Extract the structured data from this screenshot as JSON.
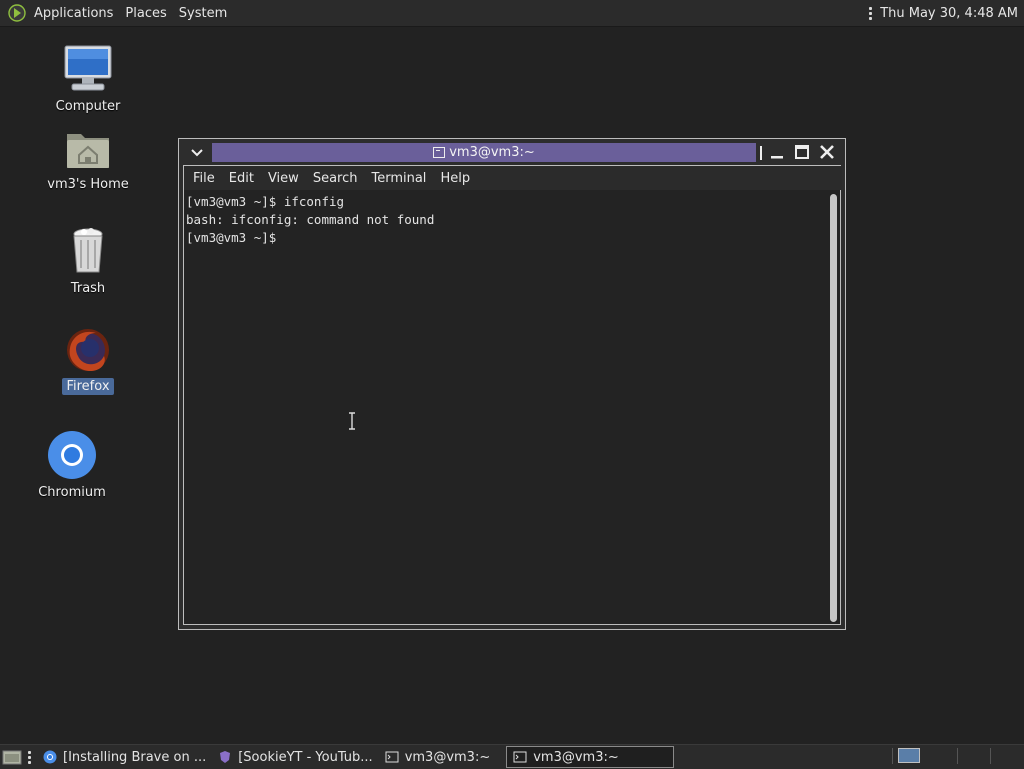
{
  "top_panel": {
    "menus": [
      "Applications",
      "Places",
      "System"
    ],
    "clock": "Thu May 30,  4:48 AM"
  },
  "desktop": {
    "icons": [
      {
        "label": "Computer",
        "icon": "computer-icon"
      },
      {
        "label": "vm3's Home",
        "icon": "home-folder-icon"
      },
      {
        "label": "Trash",
        "icon": "trash-icon"
      },
      {
        "label": "Firefox",
        "icon": "firefox-icon",
        "selected": true
      },
      {
        "label": "Chromium",
        "icon": "chromium-icon"
      }
    ]
  },
  "window": {
    "title": "vm3@vm3:~",
    "menu": [
      "File",
      "Edit",
      "View",
      "Search",
      "Terminal",
      "Help"
    ],
    "terminal_lines": [
      "[vm3@vm3 ~]$ ifconfig",
      "bash: ifconfig: command not found",
      "[vm3@vm3 ~]$ "
    ]
  },
  "taskbar": {
    "tasks": [
      {
        "label": "[Installing Brave on ...",
        "icon": "chromium-icon",
        "active": false
      },
      {
        "label": "[SookieYT - YouTub...",
        "icon": "brave-icon",
        "active": false
      },
      {
        "label": "vm3@vm3:~",
        "icon": "terminal-icon",
        "active": false
      },
      {
        "label": "vm3@vm3:~",
        "icon": "terminal-icon",
        "active": true
      }
    ]
  },
  "colors": {
    "desktop_bg": "#222222",
    "title_bar_accent": "#6a5f9a",
    "selection": "#4a6a9a"
  }
}
